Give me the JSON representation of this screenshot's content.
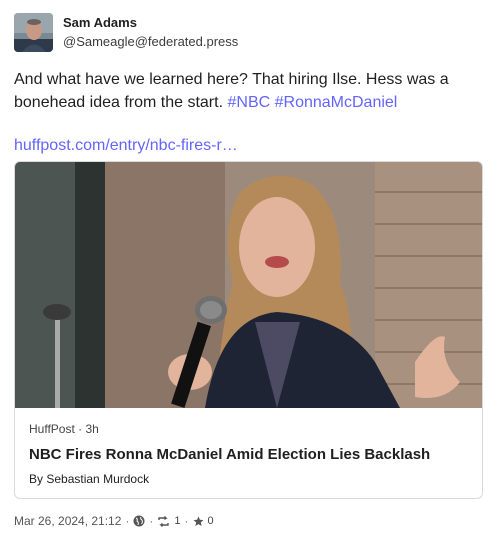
{
  "author": {
    "display_name": "Sam Adams",
    "handle": "@Sameagle@federated.press"
  },
  "post": {
    "text": "And what have we learned here? That hiring Ilse. Hess was a bonehead idea from the start.",
    "hashtags": [
      "#NBC",
      "#RonnaMcDaniel"
    ],
    "link_text": "huffpost.com/entry/nbc-fires-r…"
  },
  "card": {
    "source": "HuffPost",
    "age": "3h",
    "title": "NBC Fires Ronna McDaniel Amid Election Lies Backlash",
    "byline_prefix": "By",
    "author": "Sebastian Murdock"
  },
  "footer": {
    "timestamp": "Mar 26, 2024, 21:12",
    "visibility_icon": "globe-icon",
    "boost_icon": "boost-icon",
    "boost_count": "1",
    "favourite_icon": "star-icon",
    "favourite_count": "0",
    "separator": "·"
  },
  "colors": {
    "accent": "#6364ff",
    "text": "#1f1f1f",
    "border": "#d9d9de"
  }
}
